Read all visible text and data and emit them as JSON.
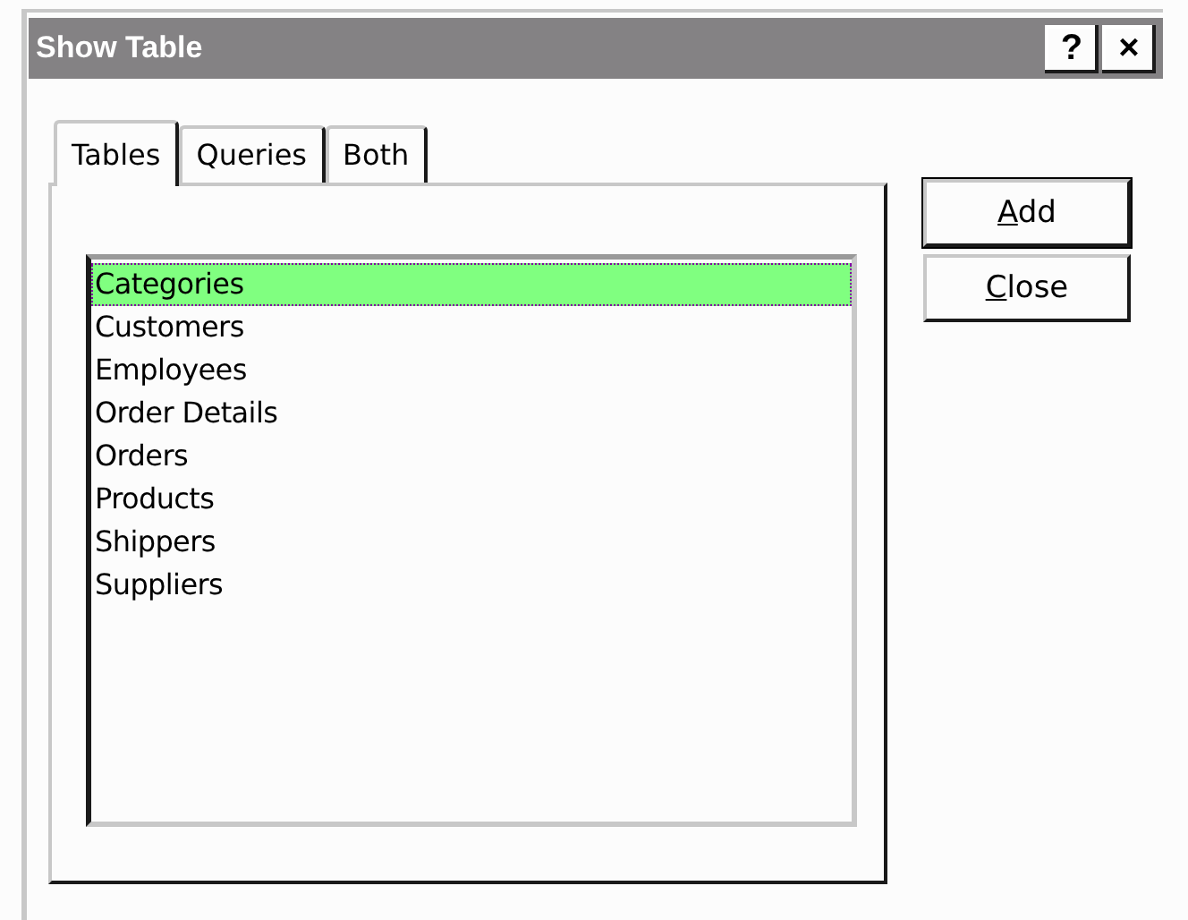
{
  "window": {
    "title": "Show Table",
    "title_buttons": [
      "?",
      "×"
    ]
  },
  "tabs": [
    {
      "label": "Tables",
      "selected": true
    },
    {
      "label": "Queries",
      "selected": false
    },
    {
      "label": "Both",
      "selected": false
    }
  ],
  "list": {
    "items": [
      {
        "label": "Categories",
        "selected": true
      },
      {
        "label": "Customers",
        "selected": false
      },
      {
        "label": "Employees",
        "selected": false
      },
      {
        "label": "Order Details",
        "selected": false
      },
      {
        "label": "Orders",
        "selected": false
      },
      {
        "label": "Products",
        "selected": false
      },
      {
        "label": "Shippers",
        "selected": false
      },
      {
        "label": "Suppliers",
        "selected": false
      }
    ]
  },
  "buttons": [
    {
      "label": "**A**dd",
      "default": true
    },
    {
      "label": "**C**lose",
      "default": false
    }
  ]
}
